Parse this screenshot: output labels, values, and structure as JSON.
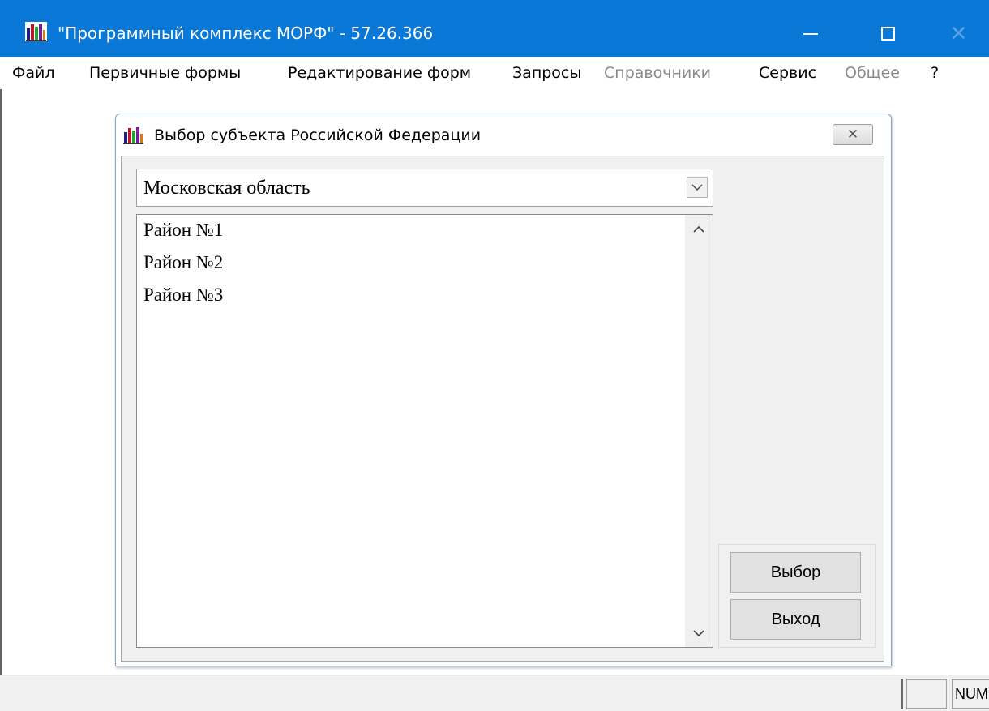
{
  "window": {
    "title": "\"Программный комплекс МОРФ\" - 57.26.366",
    "icon": "bar-chart-app-icon"
  },
  "menu": [
    {
      "label": "Файл",
      "enabled": true
    },
    {
      "label": "Первичные формы",
      "enabled": true
    },
    {
      "label": "Редактирование форм",
      "enabled": true
    },
    {
      "label": "Запросы",
      "enabled": true
    },
    {
      "label": "Справочники",
      "enabled": false
    },
    {
      "label": "Сервис",
      "enabled": true
    },
    {
      "label": "Общее",
      "enabled": false
    },
    {
      "label": "?",
      "enabled": true
    }
  ],
  "dialog": {
    "title": "Выбор субъекта Российской Федерации",
    "close_glyph": "✕",
    "combo": {
      "value": "Московская область"
    },
    "list": {
      "items": [
        "Район №1",
        "Район №2",
        "Район №3"
      ]
    },
    "buttons": {
      "select": "Выбор",
      "exit": "Выход"
    }
  },
  "statusbar": {
    "indicator": "NUM"
  },
  "colors": {
    "titlebar": "#0a78d7",
    "disabled_text": "#8a8a8a"
  }
}
